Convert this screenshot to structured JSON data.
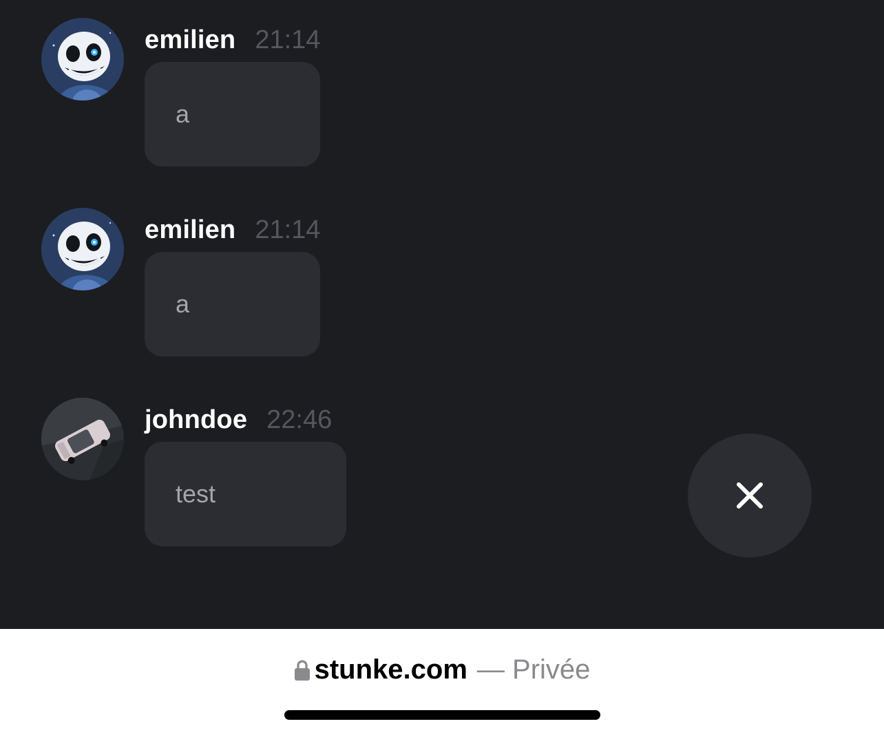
{
  "messages": [
    {
      "username": "emilien",
      "time": "21:14",
      "text": "a",
      "avatar": "skeleton-avatar"
    },
    {
      "username": "emilien",
      "time": "21:14",
      "text": "a",
      "avatar": "skeleton-avatar"
    },
    {
      "username": "johndoe",
      "time": "22:46",
      "text": "test",
      "avatar": "car-avatar"
    }
  ],
  "close_button": {
    "icon": "close-icon"
  },
  "browser": {
    "lock_icon": "lock-icon",
    "domain": "stunke.com",
    "separator": "—",
    "mode": "Privée"
  },
  "colors": {
    "chat_background": "#1c1d21",
    "bubble_background": "#2b2d32",
    "username": "#ffffff",
    "timestamp": "#55575d",
    "message_text": "#a4a6ab",
    "browser_background": "#ffffff",
    "browser_secondary_text": "#8a8a8e"
  }
}
